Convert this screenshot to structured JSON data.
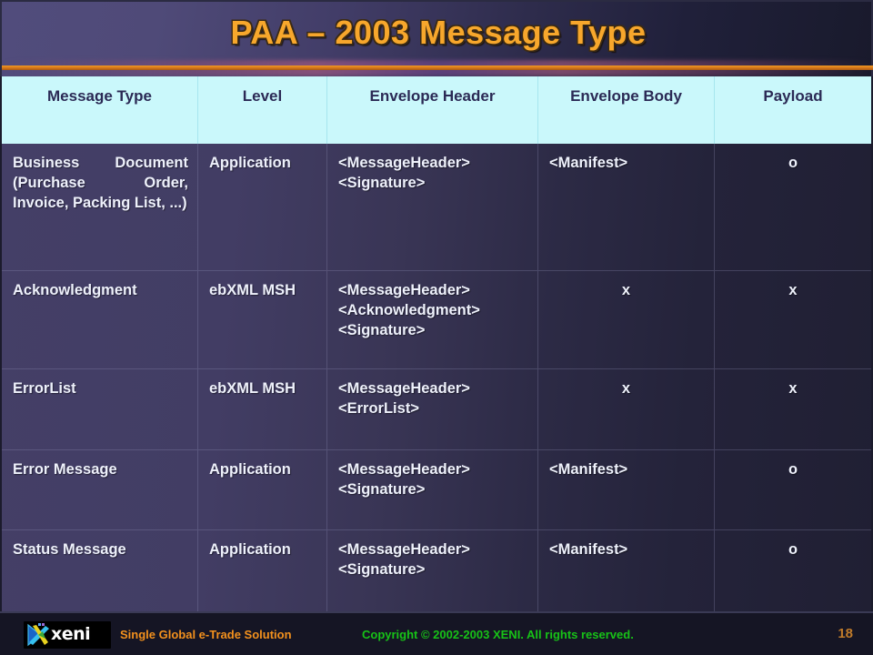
{
  "slide": {
    "title": "PAA – 2003 Message Type",
    "accent_orange": "#f7a72c",
    "header_bg": "#caf8fb",
    "body_bg": "#443f67"
  },
  "table": {
    "columns": [
      {
        "label": "Message Type"
      },
      {
        "label": "Level"
      },
      {
        "label": "Envelope Header"
      },
      {
        "label": "Envelope Body"
      },
      {
        "label": "Payload"
      }
    ],
    "rows": [
      {
        "message_type": "Business Document (Purchase Order, Invoice, Packing List, ...)",
        "level": "Application",
        "envelope_header": "<MessageHeader>\n<Signature>",
        "envelope_body": "<Manifest>",
        "payload": "o"
      },
      {
        "message_type": "Acknowledgment",
        "level": "ebXML MSH",
        "envelope_header": "<MessageHeader>\n<Acknowledgment>\n<Signature>",
        "envelope_body": "x",
        "payload": "x"
      },
      {
        "message_type": "ErrorList",
        "level": "ebXML MSH",
        "envelope_header": "<MessageHeader>\n<ErrorList>",
        "envelope_body": "x",
        "payload": "x"
      },
      {
        "message_type": "Error Message",
        "level": "Application",
        "envelope_header": "<MessageHeader>\n<Signature>",
        "envelope_body": "<Manifest>",
        "payload": "o"
      },
      {
        "message_type": "Status Message",
        "level": "Application",
        "envelope_header": "<MessageHeader>\n<Signature>",
        "envelope_body": "<Manifest>",
        "payload": "o"
      }
    ]
  },
  "footer": {
    "logo_text": "xeni",
    "tagline": "Single Global e-Trade Solution",
    "copyright": "Copyright © 2002-2003 XENI. All rights reserved.",
    "page_number": "18"
  }
}
